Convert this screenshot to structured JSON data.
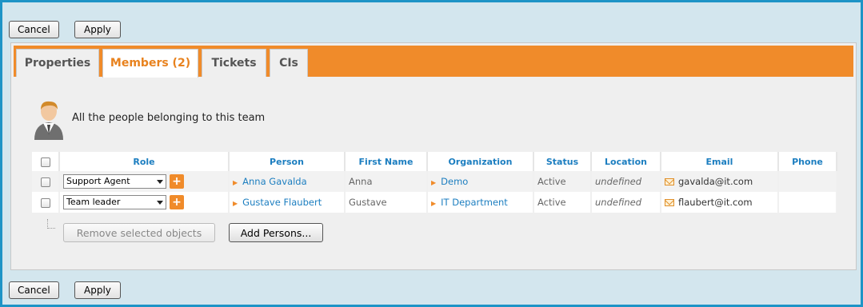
{
  "toolbar": {
    "cancel": "Cancel",
    "apply": "Apply"
  },
  "tabs": [
    "Properties",
    "Members (2)",
    "Tickets",
    "CIs"
  ],
  "active_tab": "Members (2)",
  "intro": "All the people belonging to this team",
  "columns": [
    "Role",
    "Person",
    "First Name",
    "Organization",
    "Status",
    "Location",
    "Email",
    "Phone"
  ],
  "rows": [
    {
      "role": "Support Agent",
      "person": "Anna Gavalda",
      "first_name": "Anna",
      "organization": "Demo",
      "status": "Active",
      "location": "undefined",
      "email": "gavalda@it.com",
      "phone": ""
    },
    {
      "role": "Team leader",
      "person": "Gustave Flaubert",
      "first_name": "Gustave",
      "organization": "IT Department",
      "status": "Active",
      "location": "undefined",
      "email": "flaubert@it.com",
      "phone": ""
    }
  ],
  "actions": {
    "remove": "Remove selected objects",
    "add": "Add Persons..."
  },
  "colors": {
    "accent": "#f08b2a",
    "link": "#1c7ec0",
    "border": "#1e94c6"
  },
  "icons": [
    "person-icon",
    "mail-icon",
    "plus-icon",
    "chevron-down-icon",
    "bullet-arrow-icon"
  ]
}
